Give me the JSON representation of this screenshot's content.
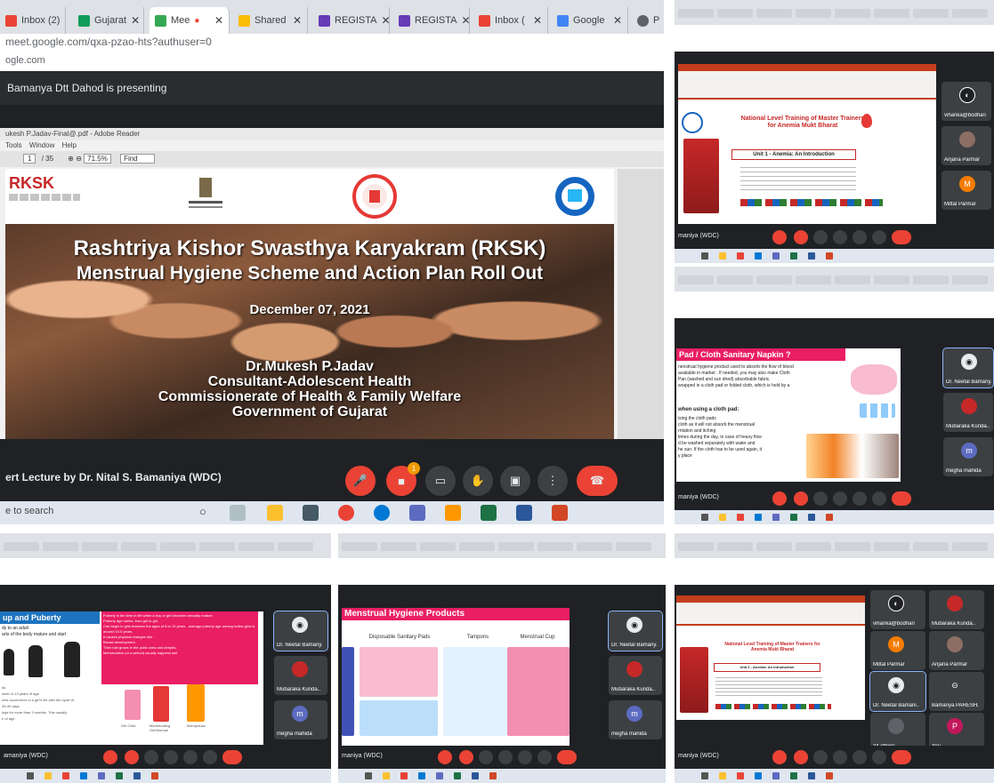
{
  "main": {
    "tabs": [
      {
        "label": "Inbox (2)",
        "color": "#ea4335"
      },
      {
        "label": "Gujarat",
        "color": "#0f9d58"
      },
      {
        "label": "Mee",
        "color": "#34a853"
      },
      {
        "label": "Shared",
        "color": "#fbbc04"
      },
      {
        "label": "REGISTA",
        "color": "#673ab7"
      },
      {
        "label": "REGISTA",
        "color": "#673ab7"
      },
      {
        "label": "Inbox (",
        "color": "#ea4335"
      },
      {
        "label": "Google",
        "color": "#4285f4"
      },
      {
        "label": "P",
        "color": "#5f6368"
      }
    ],
    "url": "meet.google.com/qxa-pzao-hts?authuser=0",
    "subdomain": "ogle.com",
    "presenter_text": "Bamanya Dtt Dahod is presenting",
    "pdf_title": "ukesh P.Jadav-Final@.pdf - Adobe Reader",
    "pdf_menu": "Tools  Window  Help",
    "pdf_page": "1",
    "pdf_pages": "/ 35",
    "pdf_zoom": "71.5%",
    "pdf_find": "Find",
    "slide": {
      "logo_text": "RKSK",
      "title": "Rashtriya Kishor Swasthya Karyakram (RKSK)",
      "subtitle": "Menstrual Hygiene Scheme and Action Plan Roll Out",
      "date": "December 07, 2021",
      "author_lines": [
        "Dr.Mukesh P.Jadav",
        "Consultant-Adolescent Health",
        "Commissionerate of Health & Family  Welfare",
        "Government of Gujarat"
      ]
    },
    "lecture_label": "ert Lecture by Dr. Nital S. Bamaniya (WDC)",
    "taskbar_search": "e to search",
    "notification_count": "1"
  },
  "top_right": {
    "slide_title": "National Level Training of Master Trainers for Anemia Mukt Bharat",
    "unit_label": "Unit 1 - Anemia: An Introduction",
    "participants": [
      {
        "name": "viharika@bodhari",
        "initial": "",
        "color": "#202124"
      },
      {
        "name": "Anjana Parmar",
        "initial": "",
        "color": "#8d6e63"
      },
      {
        "name": "Mittal Parmar",
        "initial": "M",
        "color": "#f57c00"
      }
    ],
    "label": "maniya (WDC)"
  },
  "mid_right": {
    "slide_title": "Pad / Cloth Sanitary Napkin ?",
    "body": [
      "nenstrual hygiene product used to absorb the flow of blood",
      "available in market . If needed, you may also make Cloth",
      "Pan (washed and sun dried) absorbable fabric.",
      "wrapped in a cloth pad or folded cloth, which is held by a"
    ],
    "subhead": "when using a cloth pad:",
    "list": [
      "ising the cloth pads",
      "cloth as it will not absorb the menstrual",
      "rritation and itching",
      "times during the day, in case of heavy  flow",
      "d be washed separately with water and",
      "he sun. If the cloth has to be used again, it",
      "y place"
    ],
    "participants": [
      {
        "name": "Dr. Neetal Bamany..",
        "initial": "",
        "color": "#e8eaed"
      },
      {
        "name": "Mubaraka Kunda..",
        "initial": "",
        "color": "#c62828"
      },
      {
        "name": "megha mahida",
        "initial": "m",
        "color": "#5c6bc0"
      }
    ],
    "label": "maniya (WDC)"
  },
  "bottom_left": {
    "slide_title": "up and Puberty",
    "intro": [
      "dy to an adult",
      "arts of the body mature and start"
    ],
    "pink_points": [
      "Puberty is the time in life when a boy or girl becomes sexually mature",
      "Puberty age varies, from girl to girl.",
      "Can begin in girls between the ages of 8 to 13 years - average puberty age among Indian girls is around 10.5 years.",
      "It causes physical changes like :",
      "Breast development,",
      "Then hair grows in the pubic area and armpits.",
      "Menstruation (or a period) usually happens last"
    ],
    "captions": [
      "Girl Child",
      "Menstruating Girl/Woman",
      "Menopause"
    ],
    "notes": [
      "ial.",
      "ween 8-13 years of age.",
      "uble occurrence in a girl's life with the cycle of",
      "28-40 days.",
      "ings for more than 3 months. This usually",
      "e of age."
    ],
    "participants": [
      {
        "name": "Dr. Neetal Bamany..",
        "initial": "",
        "color": "#e8eaed"
      },
      {
        "name": "Mubaraka Kunda..",
        "initial": "",
        "color": "#c62828"
      },
      {
        "name": "megha mahida",
        "initial": "m",
        "color": "#5c6bc0"
      }
    ],
    "label": "amaniya (WDC)"
  },
  "bottom_mid": {
    "slide_title": "Menstrual Hygiene Products",
    "products": [
      "Disposable Sanitary Pads",
      "Tampons",
      "Menstrual Cup"
    ],
    "participants": [
      {
        "name": "Dr. Neetal Bamany..",
        "initial": "",
        "color": "#e8eaed"
      },
      {
        "name": "Mubaraka Kunda..",
        "initial": "",
        "color": "#c62828"
      },
      {
        "name": "megha mahida",
        "initial": "m",
        "color": "#5c6bc0"
      }
    ],
    "label": "maniya (WDC)"
  },
  "bottom_right": {
    "slide_title": "National Level Training of Master Trainers for Anemia Mukt Bharat",
    "unit_label": "Unit 1 - Anemia: An Introduction",
    "participants": [
      {
        "name": "viharika@bodhari",
        "initial": "",
        "color": "#202124"
      },
      {
        "name": "Mubaraka Kunda..",
        "initial": "",
        "color": "#c62828"
      },
      {
        "name": "Mittal Parmar",
        "initial": "M",
        "color": "#f57c00"
      },
      {
        "name": "Anjana Parmar",
        "initial": "",
        "color": "#8d6e63"
      },
      {
        "name": "Dr. Neetal Bamani..",
        "initial": "",
        "color": "#e8eaed"
      },
      {
        "name": "Bamanya PARESHA BHIMA",
        "initial": "",
        "color": "#3c4043"
      },
      {
        "name": "34 others",
        "initial": "",
        "color": "#5f6368"
      },
      {
        "name": "You",
        "initial": "P",
        "color": "#c2185b"
      }
    ],
    "label": "maniya (WDC)"
  }
}
